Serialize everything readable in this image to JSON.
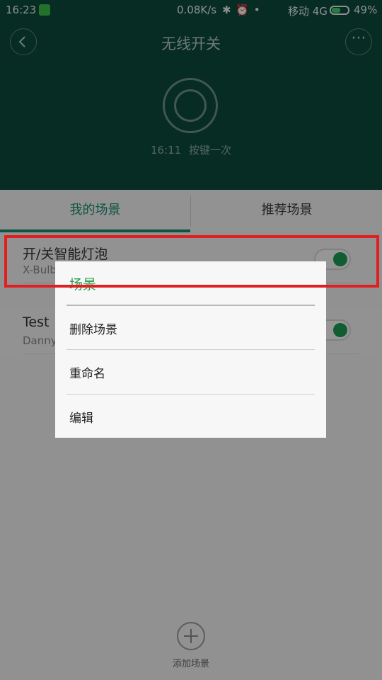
{
  "status_bar": {
    "time": "16:23",
    "network_speed": "0.08K/s",
    "system_icons": "✱ ⏰ •",
    "carrier": "移动 4G",
    "battery": "49%"
  },
  "header": {
    "title": "无线开关",
    "last_event_time": "16:11",
    "last_event_text": "按键一次",
    "more_glyph": "···"
  },
  "tabs": [
    {
      "label": "我的场景",
      "active": true
    },
    {
      "label": "推荐场景",
      "active": false
    }
  ],
  "scenes": [
    {
      "name": "开/关智能灯泡",
      "subtitle": "X-Bulb",
      "enabled": true
    },
    {
      "name": "Test",
      "subtitle": "Danny",
      "enabled": true
    }
  ],
  "add_scene": {
    "label": "添加场景"
  },
  "context_menu": {
    "title": "场景",
    "items": [
      "删除场景",
      "重命名",
      "编辑"
    ]
  },
  "colors": {
    "header_bg": "#0b4a3c",
    "accent_green": "#168c6e",
    "highlight": "#e02020"
  }
}
